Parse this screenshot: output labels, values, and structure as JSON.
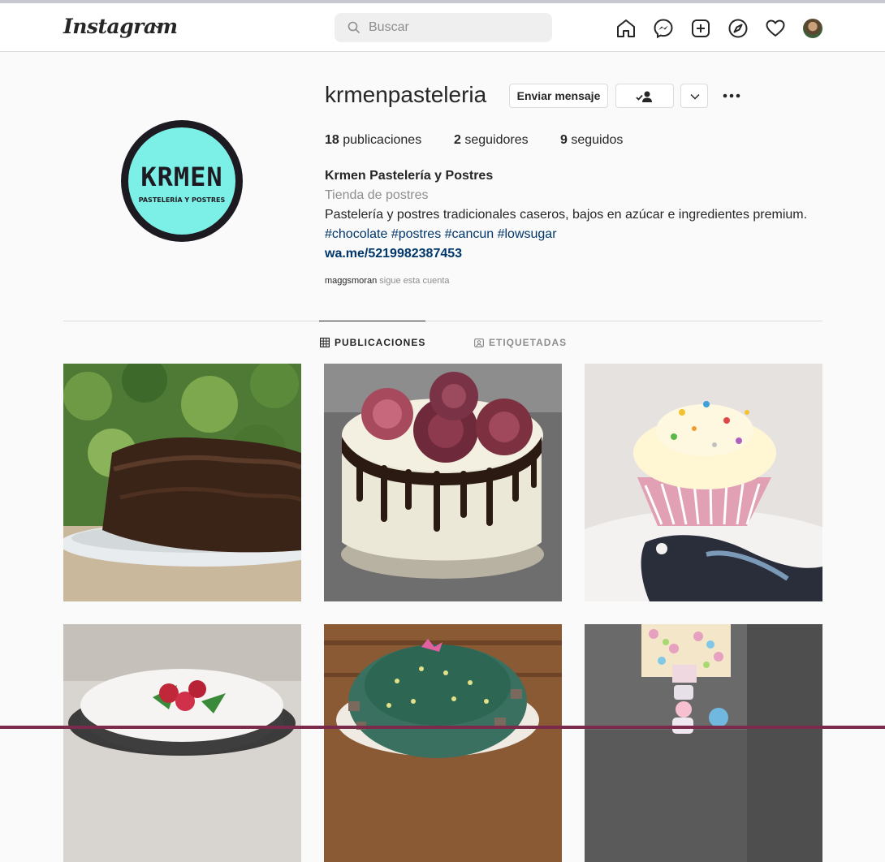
{
  "navbar": {
    "logo": "Instagram",
    "search_placeholder": "Buscar",
    "icons": [
      "home-icon",
      "messenger-icon",
      "new-post-icon",
      "explore-icon",
      "activity-heart-icon",
      "profile-avatar"
    ]
  },
  "profile": {
    "username": "krmenpasteleria",
    "picture_text": "KRMEN",
    "picture_subtext": "PASTELERÍA Y POSTRES",
    "buttons": {
      "message": "Enviar mensaje"
    },
    "stats": [
      {
        "count": "18",
        "label": "publicaciones"
      },
      {
        "count": "2",
        "label": "seguidores"
      },
      {
        "count": "9",
        "label": "seguidos"
      }
    ],
    "bio": {
      "name": "Krmen Pastelería y Postres",
      "category": "Tienda de postres",
      "text": "Pastelería y postres tradicionales caseros, bajos en azúcar e ingredientes premium.",
      "hashtags": "#chocolate #postres #cancun #lowsugar",
      "link": "wa.me/5219982387453"
    },
    "followed_by": {
      "user": "maggsmoran",
      "text": "sigue esta cuenta"
    }
  },
  "tabs": [
    {
      "label": "PUBLICACIONES",
      "active": true
    },
    {
      "label": "ETIQUETADAS",
      "active": false
    }
  ],
  "posts": [
    {
      "subject": "chocolate-cake"
    },
    {
      "subject": "drip-cake-roses"
    },
    {
      "subject": "cupcake-sprinkles"
    },
    {
      "subject": "raspberry-cake"
    },
    {
      "subject": "cactus-cake"
    },
    {
      "subject": "candy-gift-box"
    }
  ],
  "colors": {
    "link": "#00376b",
    "muted": "#8e8e8e",
    "text": "#262626",
    "logo_bg": "#7cf0e6"
  }
}
